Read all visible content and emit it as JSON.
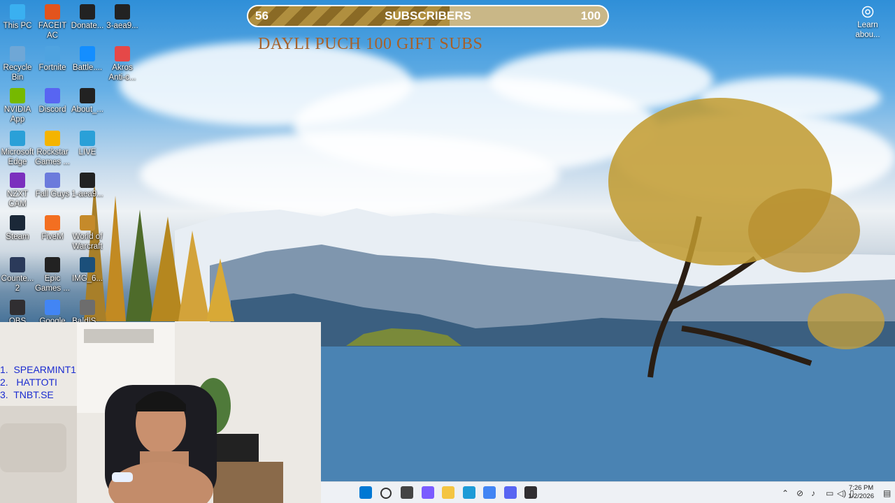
{
  "overlay": {
    "subscriber_count": "56",
    "subscriber_label": "SUBSCRIBERS",
    "subscriber_goal": "100",
    "subscriber_progress": 0.56,
    "promo_text": "DAYLI  PUCH 100 GIFT SUBS"
  },
  "desktop_icons": [
    {
      "label": "This PC",
      "icon": "this-pc-icon",
      "color": "#3ab0f0"
    },
    {
      "label": "FACEIT AC",
      "icon": "faceit-icon",
      "color": "#e3541d"
    },
    {
      "label": "Donate...",
      "icon": "donate-icon",
      "color": "#222222"
    },
    {
      "label": "3-aea9...",
      "icon": "file-icon",
      "color": "#222222"
    },
    {
      "label": "Recycle Bin",
      "icon": "recycle-bin-icon",
      "color": "#6fa7d6"
    },
    {
      "label": "Fortnite",
      "icon": "fortnite-icon",
      "color": "#4fa3e0"
    },
    {
      "label": "Battle....",
      "icon": "battlenet-icon",
      "color": "#148eff"
    },
    {
      "label": "Akros Anti-c...",
      "icon": "akros-icon",
      "color": "#e54848"
    },
    {
      "label": "NVIDIA App",
      "icon": "nvidia-icon",
      "color": "#76b900"
    },
    {
      "label": "Discord",
      "icon": "discord-icon",
      "color": "#5865f2"
    },
    {
      "label": "About_...",
      "icon": "file-icon",
      "color": "#222222"
    },
    {
      "label": "Microsoft Edge",
      "icon": "edge-icon",
      "color": "#2aa0d8"
    },
    {
      "label": "Rockstar Games ...",
      "icon": "rockstar-icon",
      "color": "#f4b400"
    },
    {
      "label": "LIVE",
      "icon": "edge-icon",
      "color": "#2aa0d8"
    },
    {
      "label": "NZXT CAM",
      "icon": "nzxt-icon",
      "color": "#7b2fbe"
    },
    {
      "label": "Fall Guys",
      "icon": "fallguys-icon",
      "color": "#6b7bdc"
    },
    {
      "label": "1-aea9...",
      "icon": "file-icon",
      "color": "#222222"
    },
    {
      "label": "Steam",
      "icon": "steam-icon",
      "color": "#1b2838"
    },
    {
      "label": "FiveM",
      "icon": "fivem-icon",
      "color": "#f36f21"
    },
    {
      "label": "World of Warcraft",
      "icon": "wow-icon",
      "color": "#c58a2a"
    },
    {
      "label": "Counte... 2",
      "icon": "cs2-icon",
      "color": "#2b3a5a"
    },
    {
      "label": "Epic Games ...",
      "icon": "epic-icon",
      "color": "#222222"
    },
    {
      "label": "IMG_6...",
      "icon": "image-icon",
      "color": "#1b4f7a"
    },
    {
      "label": "OBS",
      "icon": "obs-icon",
      "color": "#302e31"
    },
    {
      "label": "Google",
      "icon": "chrome-icon",
      "color": "#4285f4"
    },
    {
      "label": "Ba|d|S...",
      "icon": "image-icon",
      "color": "#6d6d6d"
    }
  ],
  "webcam_list": [
    "1.  SPEARMINT1",
    "2.   HATTOTI",
    "3.  TNBT.SE"
  ],
  "learn_widget": {
    "label": "Learn abou...",
    "icon": "camera-icon"
  },
  "taskbar": {
    "pinned": [
      {
        "name": "start-button",
        "icon": "windows-icon"
      },
      {
        "name": "search-button",
        "icon": "search-icon"
      },
      {
        "name": "task-view-button",
        "icon": "task-view-icon"
      },
      {
        "name": "copilot-button",
        "icon": "copilot-icon"
      },
      {
        "name": "file-explorer-button",
        "icon": "folder-icon"
      },
      {
        "name": "edge-button",
        "icon": "edge-icon"
      },
      {
        "name": "chrome-button",
        "icon": "chrome-icon"
      },
      {
        "name": "discord-button",
        "icon": "discord-icon"
      },
      {
        "name": "obs-button",
        "icon": "obs-icon"
      }
    ],
    "time": "7:26 PM",
    "date": "1/2/2026"
  }
}
